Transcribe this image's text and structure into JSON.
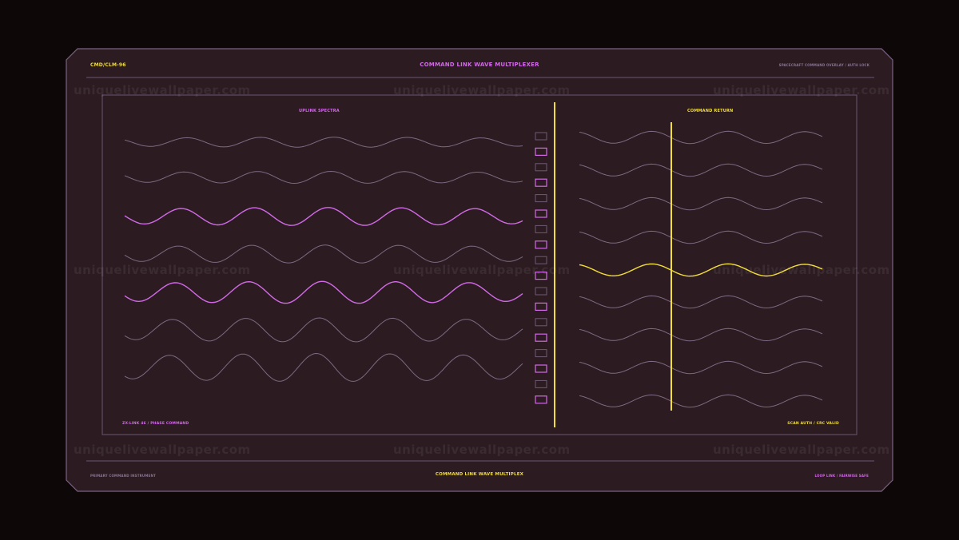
{
  "header": {
    "code": "CMD/CLM-96",
    "title": "COMMAND LINK WAVE MULTIPLEXER",
    "subtitle": "SPACECRAFT COMMAND OVERLAY / AUTH LOCK"
  },
  "left_panel": {
    "title": "UPLINK SPECTRA",
    "footer": "ZX-LINK 46 / PHASE COMMAND"
  },
  "right_panel": {
    "title": "COMMAND RETURN",
    "footer": "SCAN AUTH / CRC VALID"
  },
  "footer": {
    "left": "PRIMARY COMMAND INSTRUMENT",
    "center": "COMMAND LINK WAVE MULTIPLEX",
    "right": "LOOP LINK / FAIRWISE SAFE"
  },
  "watermark": "uniquelivewallpaper.com",
  "colors": {
    "background": "#0e0707",
    "panel": "#2c1b21",
    "border": "#7a6284",
    "magenta": "#d26ae8",
    "yellow": "#f2de3a",
    "wave_dim": "#7e6a82"
  },
  "left_waves": [
    {
      "highlight": false
    },
    {
      "highlight": false
    },
    {
      "highlight": true
    },
    {
      "highlight": false
    },
    {
      "highlight": true
    },
    {
      "highlight": false
    },
    {
      "highlight": false
    }
  ],
  "right_waves": [
    {
      "highlight": false
    },
    {
      "highlight": false
    },
    {
      "highlight": false
    },
    {
      "highlight": false
    },
    {
      "highlight": true
    },
    {
      "highlight": false
    },
    {
      "highlight": false
    },
    {
      "highlight": false
    },
    {
      "highlight": false
    }
  ],
  "indicators": [
    false,
    true,
    false,
    true,
    false,
    true,
    false,
    true,
    false,
    true,
    false,
    true,
    false,
    true,
    false,
    true,
    false,
    true
  ]
}
